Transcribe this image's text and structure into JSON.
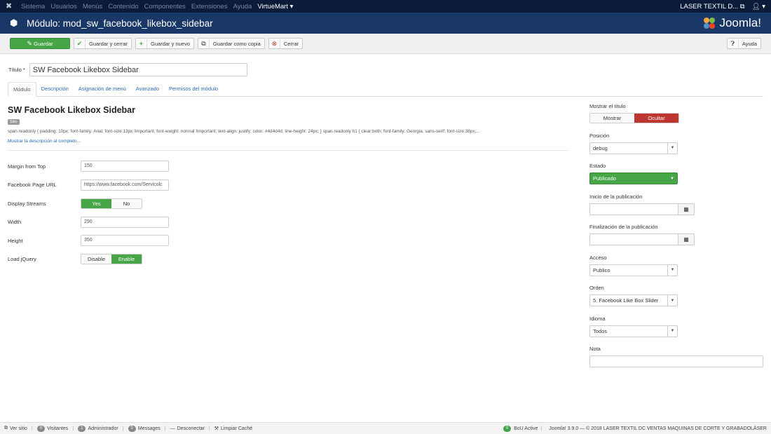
{
  "topnav": {
    "menu": [
      "Sistema",
      "Usuarios",
      "Menús",
      "Contenido",
      "Componentes",
      "Extensiones",
      "Ayuda",
      "VirtueMart ▾"
    ],
    "site_name": "LASER TEXTIL D...",
    "user_icon": "user-icon"
  },
  "header": {
    "title": "Módulo: mod_sw_facebook_likebox_sidebar",
    "logo_text": "Joomla!"
  },
  "toolbar": {
    "save": "Guardar",
    "save_close": "Guardar y cerrar",
    "save_new": "Guardar y nuevo",
    "save_copy": "Guardar como copia",
    "close": "Cerrar",
    "help": "Ayuda"
  },
  "form": {
    "title_label": "Título *",
    "title_value": "SW Facebook Likebox Sidebar"
  },
  "tabs": [
    "Módulo",
    "Descripción",
    "Asignación de menú",
    "Avanzado",
    "Permisos del módulo"
  ],
  "module": {
    "heading": "SW Facebook Likebox Sidebar",
    "badge": "Sitio",
    "description": "span.readonly { padding: 10px; font-family: Arial; font-size:13px !important; font-weight: normal !important; text-align: justify; color: #4d4d4d; line-height: 24px; } span.readonly h1 { clear:both; font-family: Georgia, sans-serif; font-size:38px;...",
    "more_link": "Mostrar la descripción al completo..."
  },
  "fields": {
    "margin_label": "Margin from Top",
    "margin_value": "150",
    "url_label": "Facebook Page URL",
    "url_value": "https://www.facebook.com/Servicolc",
    "streams_label": "Display Streams",
    "streams_yes": "Yes",
    "streams_no": "No",
    "width_label": "Width",
    "width_value": "290",
    "height_label": "Height",
    "height_value": "350",
    "jquery_label": "Load jQuery",
    "jquery_disable": "Disable",
    "jquery_enable": "Enable"
  },
  "sidebar": {
    "show_title_label": "Mostrar el título",
    "show": "Mostrar",
    "hide": "Ocultar",
    "position_label": "Posición",
    "position_value": "debug",
    "state_label": "Estado",
    "state_value": "Publicado",
    "publish_start_label": "Inicio de la publicación",
    "publish_end_label": "Finalización de la publicación",
    "access_label": "Acceso",
    "access_value": "Publico",
    "order_label": "Orden",
    "order_value": "5. Facebook Like Box Slider",
    "language_label": "Idioma",
    "language_value": "Todos",
    "note_label": "Nota"
  },
  "statusbar": {
    "view_site": "Ver sitio",
    "visitors_count": "0",
    "visitors": "Visitantes",
    "admin_count": "1",
    "admin": "Administrador",
    "messages_count": "0",
    "messages": "Messages",
    "logout": "Desconectar",
    "clear_cache": "Limpiar Caché",
    "bou_count": "0",
    "bou": "BoU Active",
    "copyright": "Joomla! 3.9.0 — © 2018 LASER TEXTIL DC VENTAS MAQUINAS DE CORTE Y GRABADOLÁSER"
  },
  "colors": {
    "nav_bg": "#0b1c3a",
    "header_bg": "#1a3867",
    "success": "#46a546",
    "danger": "#bd362f",
    "link": "#2a69b8"
  }
}
